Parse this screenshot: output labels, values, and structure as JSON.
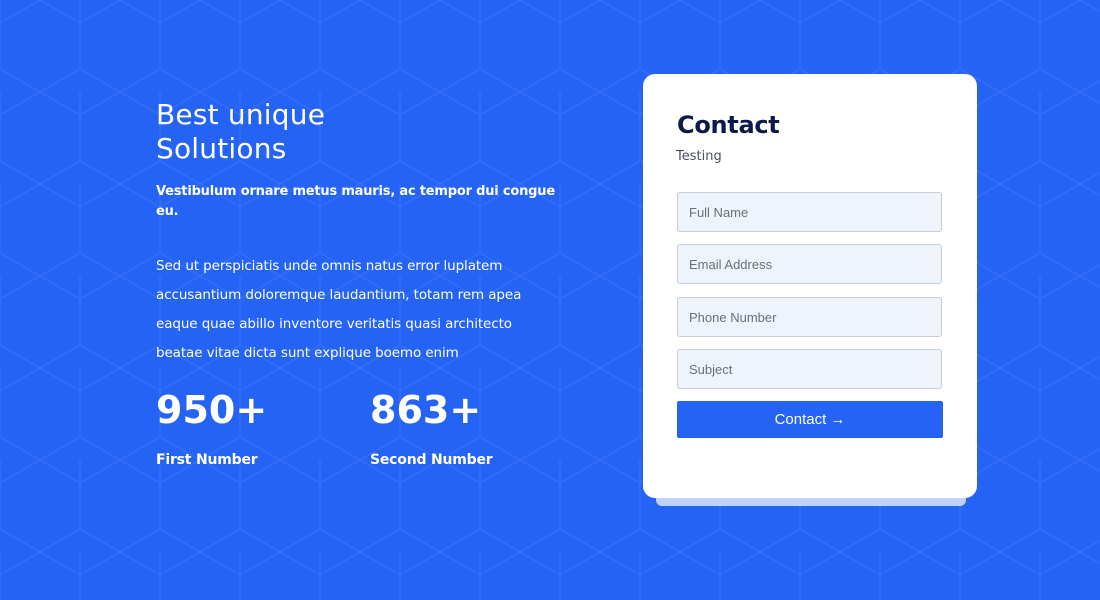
{
  "colors": {
    "background": "#2563f5",
    "card": "#ffffff",
    "title": "#0b1a4a",
    "accent": "#2563f5",
    "field_bg": "#eef3fc"
  },
  "hero": {
    "headline_line1": "Best unique",
    "headline_line2": "Solutions",
    "tagline": "Vestibulum ornare metus mauris, ac tempor dui congue eu.",
    "body": "Sed ut perspiciatis unde omnis natus error luplatem accusantium doloremque laudantium, totam rem apea eaque quae abillo inventore veritatis quasi architecto beatae vitae dicta sunt explique boemo enim"
  },
  "stats": [
    {
      "value": "950+",
      "label": "First Number"
    },
    {
      "value": "863+",
      "label": "Second Number"
    }
  ],
  "contact_form": {
    "title": "Contact",
    "subtitle": "Testing",
    "fields": {
      "full_name": {
        "placeholder": "Full Name",
        "value": ""
      },
      "email": {
        "placeholder": "Email Address",
        "value": ""
      },
      "phone": {
        "placeholder": "Phone Number",
        "value": ""
      },
      "subject": {
        "placeholder": "Subject",
        "value": ""
      }
    },
    "submit_label": "Contact →"
  }
}
